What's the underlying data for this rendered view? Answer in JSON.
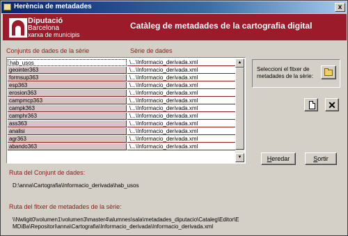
{
  "window": {
    "title": "Herència de metadades",
    "close_label": "x"
  },
  "banner": {
    "org_line1": "Diputació",
    "org_line2": "Barcelona",
    "org_line3": "xarxa de municipis",
    "title": "Catàleg de metadades de la cartografia digital"
  },
  "headers": {
    "col1": "Conjunts de dades de la sèrie",
    "col2": "Sèrie de dades"
  },
  "table": {
    "rows": [
      {
        "name": "hab_usos",
        "serie": "\\...\\Informacio_derivada.xml"
      },
      {
        "name": "geointer363",
        "serie": "\\...\\Informacio_derivada.xml"
      },
      {
        "name": "formsup363",
        "serie": "\\...\\Informacio_derivada.xml"
      },
      {
        "name": "esp363",
        "serie": "\\...\\Informacio_derivada.xml"
      },
      {
        "name": "erosion363",
        "serie": "\\...\\Informacio_derivada.xml"
      },
      {
        "name": "campmcp363",
        "serie": "\\...\\Informacio_derivada.xml"
      },
      {
        "name": "campk363",
        "serie": "\\...\\Informacio_derivada.xml"
      },
      {
        "name": "camphr363",
        "serie": "\\...\\Informacio_derivada.xml"
      },
      {
        "name": "ass363",
        "serie": "\\...\\Informacio_derivada.xml"
      },
      {
        "name": "analisi",
        "serie": "\\...\\Informacio_derivada.xml"
      },
      {
        "name": "agr363",
        "serie": "\\...\\Informacio_derivada.xml"
      },
      {
        "name": "abando363",
        "serie": "\\...\\Informacio_derivada.xml"
      }
    ]
  },
  "scroll": {
    "up": "▲",
    "down": "▼"
  },
  "select_file": {
    "label": "Seleccioni el fitxer de metadades de la sèrie:"
  },
  "buttons": {
    "heredar_prefix": "",
    "heredar_accel": "H",
    "heredar_rest": "eredar",
    "sortir_prefix": "",
    "sortir_accel": "S",
    "sortir_rest": "ortir",
    "delete_glyph": "✕"
  },
  "ruta_conjunt": {
    "label": "Ruta del Conjunt de dades:",
    "value": "D:\\anna\\Cartografia\\Informacio_derivada\\hab_usos"
  },
  "ruta_fitxer": {
    "label": "Ruta del fitxer de metadades de la sèrie:",
    "value_line1": "\\\\Nwligit0\\volumen1\\volumen3\\master4\\alumnes\\sala\\metadades_diputacio\\Cataleg\\Editor\\E",
    "value_line2": "MDiBa\\Repositori\\anna\\Cartografia\\Informacio_derivada\\Informacio_derivada.xml"
  }
}
